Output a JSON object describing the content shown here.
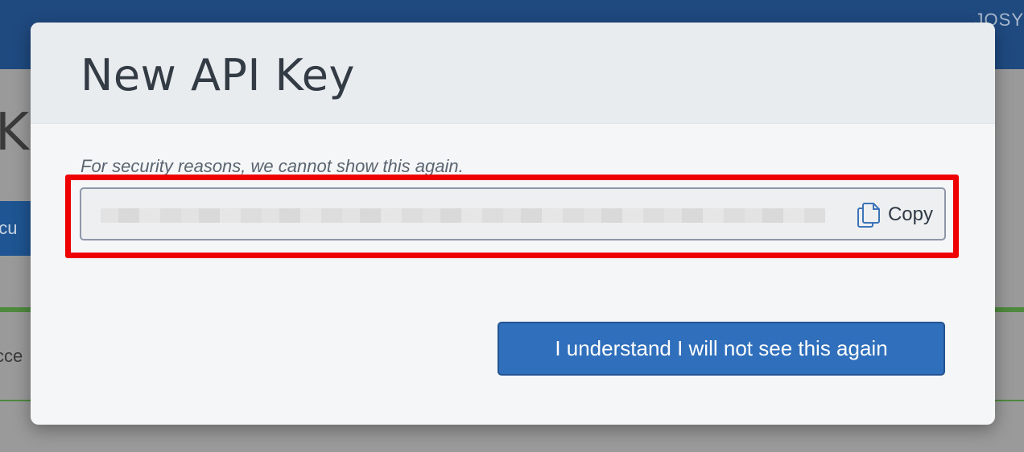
{
  "background": {
    "user_name": "JOSY",
    "heading_fragment": "K",
    "tab_fragment": "ocu",
    "access_fragment": "cce"
  },
  "modal": {
    "title": "New API Key",
    "notice": "For security reasons, we cannot show this again.",
    "key_value": "",
    "copy_label": "Copy",
    "confirm_label": "I understand I will not see this again"
  },
  "colors": {
    "primary_button": "#2f6fbc",
    "highlight_border": "#ee0000",
    "topbar": "#1f4a80"
  },
  "icons": {
    "copy": "copy-icon"
  }
}
